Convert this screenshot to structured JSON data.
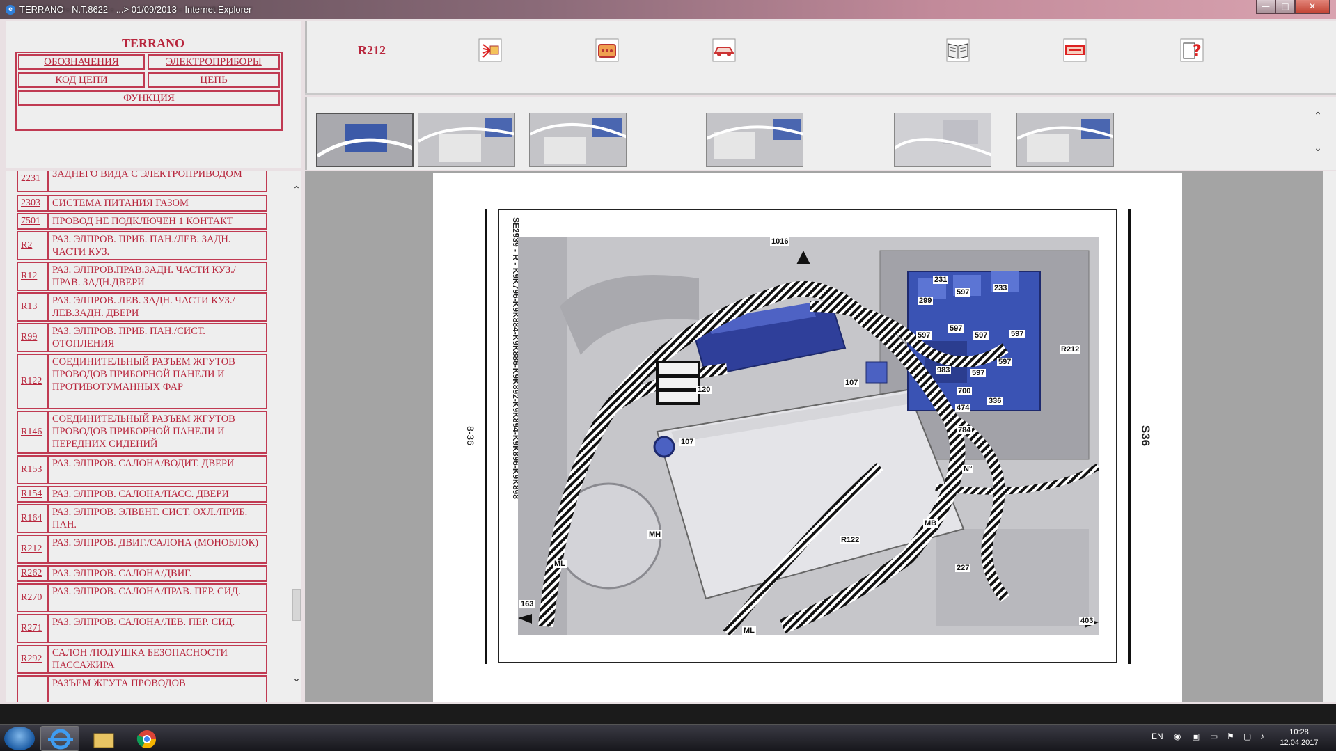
{
  "window": {
    "title": "TERRANO - N.T.8622 - ...> 01/09/2013 - Internet Explorer",
    "min": "—",
    "max": "□",
    "close": "✕"
  },
  "nav": {
    "brand": "TERRANO",
    "items": {
      "designations": "ОБОЗНАЧЕНИЯ",
      "devices": "ЭЛЕКТРОПРИБОРЫ",
      "circuit_code": "КОД ЦЕПИ",
      "circuit": "ЦЕПЬ",
      "function": "ФУНКЦИЯ"
    }
  },
  "toolbar": {
    "code": "R212",
    "icons": [
      "wiring-icon",
      "connector-icon",
      "car-icon",
      "book-icon",
      "fuse-icon",
      "help-icon"
    ]
  },
  "list": {
    "rows": [
      {
        "code": "2231",
        "desc": "ЗАДНЕГО ВИДА С ЭЛЕКТРОПРИВОДОМ"
      },
      {
        "code": "2303",
        "desc": "СИСТЕМА ПИТАНИЯ ГАЗОМ"
      },
      {
        "code": "7501",
        "desc": "ПРОВОД НЕ ПОДКЛЮЧЕН 1 КОНТАКТ"
      },
      {
        "code": "R2",
        "desc": "РАЗ. ЭЛПРОВ. ПРИБ. ПАН./ЛЕВ. ЗАДН. ЧАСТИ КУЗ."
      },
      {
        "code": "R12",
        "desc": "РАЗ. ЭЛПРОВ.ПРАВ.ЗАДН. ЧАСТИ КУЗ./ПРАВ. ЗАДН.ДВЕРИ"
      },
      {
        "code": "R13",
        "desc": "РАЗ. ЭЛПРОВ. ЛЕВ. ЗАДН. ЧАСТИ КУЗ./ЛЕВ.ЗАДН. ДВЕРИ"
      },
      {
        "code": "R99",
        "desc": "РАЗ. ЭЛПРОВ. ПРИБ. ПАН./СИСТ. ОТОПЛЕНИЯ"
      },
      {
        "code": "R122",
        "desc": "СОЕДИНИТЕЛЬНЫЙ РАЗЪЕМ ЖГУТОВ ПРОВОДОВ ПРИБОРНОЙ ПАНЕЛИ И ПРОТИВОТУМАННЫХ ФАР"
      },
      {
        "code": "R146",
        "desc": "СОЕДИНИТЕЛЬНЫЙ РАЗЪЕМ ЖГУТОВ ПРОВОДОВ ПРИБОРНОЙ ПАНЕЛИ И ПЕРЕДНИХ СИДЕНИЙ"
      },
      {
        "code": "R153",
        "desc": "РАЗ. ЭЛПРОВ. САЛОНА/ВОДИТ. ДВЕРИ"
      },
      {
        "code": "R154",
        "desc": "РАЗ. ЭЛПРОВ. САЛОНА/ПАСС. ДВЕРИ"
      },
      {
        "code": "R164",
        "desc": "РАЗ. ЭЛПРОВ. ЭЛВЕНТ. СИСТ. ОХЛ./ПРИБ. ПАН."
      },
      {
        "code": "R212",
        "desc": "РАЗ. ЭЛПРОВ. ДВИГ./САЛОНА (МОНОБЛОК)"
      },
      {
        "code": "R262",
        "desc": "РАЗ. ЭЛПРОВ. САЛОНА/ДВИГ."
      },
      {
        "code": "R270",
        "desc": "РАЗ. ЭЛПРОВ. САЛОНА/ПРАВ. ПЕР. СИД."
      },
      {
        "code": "R271",
        "desc": "РАЗ. ЭЛПРОВ. САЛОНА/ЛЕВ. ПЕР. СИД."
      },
      {
        "code": "R292",
        "desc": "САЛОН /ПОДУШКА БЕЗОПАСНОСТИ ПАССАЖИРА"
      },
      {
        "code": "",
        "desc": "РАЗЪЕМ ЖГУТА ПРОВОДОВ"
      }
    ]
  },
  "diagram": {
    "vertical_title": "SE2939 - R - K9K796-K9K884-K9K886-K9K892-K9K894-K9K896-K9K898",
    "page_left": "8-36",
    "page_right": "S36",
    "labels": {
      "l1016": "1016",
      "l231": "231",
      "l597a": "597",
      "l233": "233",
      "l299": "299",
      "l597b": "597",
      "l597c": "597",
      "l597d": "597",
      "l597e": "597",
      "l597f": "597",
      "l597g": "597",
      "lR212": "R212",
      "l983": "983",
      "l700": "700",
      "l336": "336",
      "l474": "474",
      "l784": "784",
      "l107a": "107",
      "l120": "120",
      "l107b": "107",
      "lN": "N°",
      "lMH": "MH",
      "lR122": "R122",
      "lMB": "MB",
      "lML1": "ML",
      "l227": "227",
      "l163": "163",
      "lML2": "ML",
      "l403": "403"
    }
  },
  "taskbar": {
    "lang": "EN",
    "time": "10:28",
    "date": "12.04.2017"
  }
}
